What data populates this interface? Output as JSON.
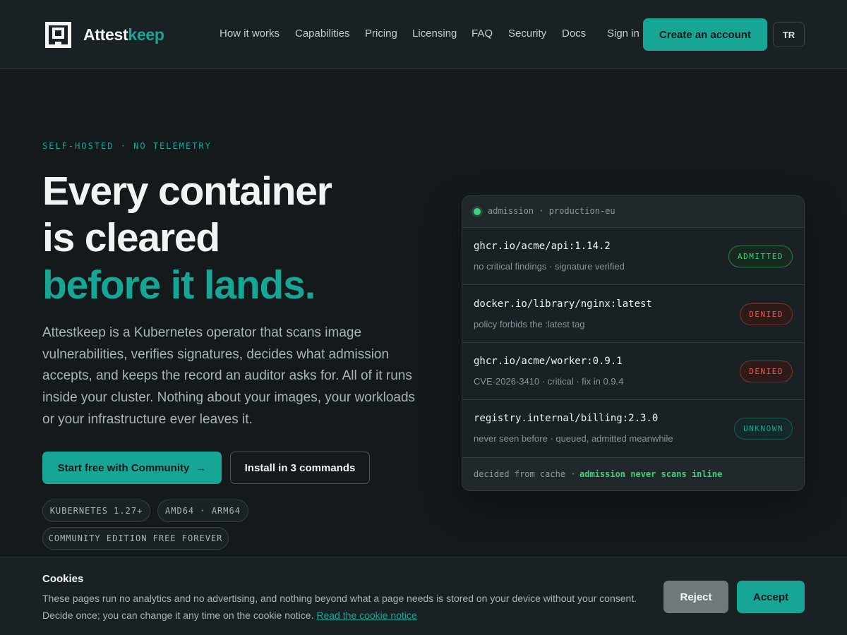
{
  "header": {
    "brand_part1": "Attest",
    "brand_part2": "keep",
    "nav": [
      "How it works",
      "Capabilities",
      "Pricing",
      "Licensing",
      "FAQ",
      "Security",
      "Docs"
    ],
    "sign_in": "Sign in",
    "create_account": "Create an account",
    "language": "TR"
  },
  "hero": {
    "eyebrow": "SELF-HOSTED · NO TELEMETRY",
    "title_line1": "Every container",
    "title_line2": "is cleared",
    "title_line3": "before it lands.",
    "lead": "Attestkeep is a Kubernetes operator that scans image vulnerabilities, verifies signatures, decides what admission accepts, and keeps the record an auditor asks for. All of it runs inside your cluster. Nothing about your images, your workloads or your infrastructure ever leaves it.",
    "primary_cta": "Start free with Community",
    "primary_cta_icon": "→",
    "secondary_cta": "Install in 3 commands",
    "chips": [
      "KUBERNETES 1.27+",
      "AMD64 · ARM64",
      "COMMUNITY EDITION FREE FOREVER"
    ]
  },
  "admission_card": {
    "title": "admission · production-eu",
    "rows": [
      {
        "image": "ghcr.io/acme/api:1.14.2",
        "detail": "no critical findings · signature verified",
        "status": "ADMITTED"
      },
      {
        "image": "docker.io/library/nginx:latest",
        "detail": "policy forbids the :latest tag",
        "status": "DENIED"
      },
      {
        "image": "ghcr.io/acme/worker:0.9.1",
        "detail": "CVE-2026-3410 · critical · fix in 0.9.4",
        "status": "DENIED"
      },
      {
        "image": "registry.internal/billing:2.3.0",
        "detail": "never seen before · queued, admitted meanwhile",
        "status": "UNKNOWN"
      }
    ],
    "footer_prefix": "decided from cache ·",
    "footer_highlight": "admission never scans inline"
  },
  "cookie": {
    "title": "Cookies",
    "text": "These pages run no analytics and no advertising, and nothing beyond what a page needs is stored on your device without your consent. Decide once; you can change it any time on the cookie notice.",
    "link": "Read the cookie notice",
    "reject": "Reject",
    "accept": "Accept"
  },
  "colors": {
    "accent": "#17a596",
    "admitted": "#3ed07a",
    "denied": "#e85d4f",
    "background": "#14191c"
  },
  "icons": {
    "logo": "attestkeep-logo-icon",
    "status_dot": "status-dot-icon",
    "arrow": "arrow-right-icon"
  }
}
